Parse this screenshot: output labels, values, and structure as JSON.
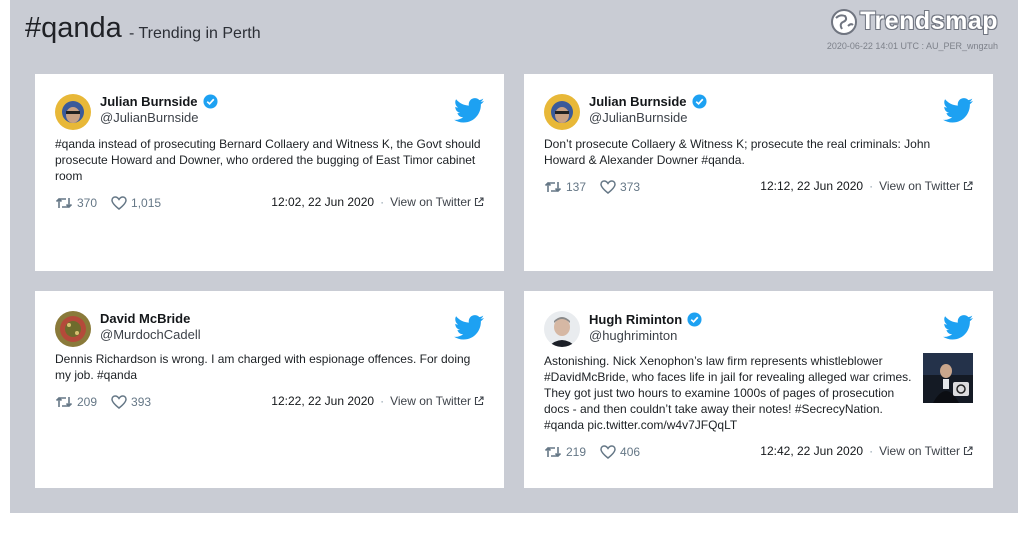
{
  "header": {
    "hashtag": "#qanda",
    "subtitle": "- Trending in Perth",
    "logo_text": "Trendsmap",
    "meta": "2020-06-22 14:01 UTC : AU_PER_wngzuh"
  },
  "tweets": [
    {
      "name": "Julian Burnside",
      "handle": "@JulianBurnside",
      "verified": true,
      "lines": [
        "#qanda instead of prosecuting Bernard Collaery and Witness K, the Govt should",
        "prosecute Howard and Downer, who ordered the bugging of East Timor cabinet",
        "room"
      ],
      "retweets": "370",
      "likes": "1,015",
      "time": "12:02, 22 Jun 2020",
      "view": "View on Twitter"
    },
    {
      "name": "Julian Burnside",
      "handle": "@JulianBurnside",
      "verified": true,
      "lines": [
        "Don’t prosecute Collaery & Witness K; prosecute the real criminals: John",
        "Howard & Alexander Downer #qanda."
      ],
      "retweets": "137",
      "likes": "373",
      "time": "12:12, 22 Jun 2020",
      "view": "View on Twitter"
    },
    {
      "name": "David McBride",
      "handle": "@MurdochCadell",
      "verified": false,
      "lines": [
        "Dennis Richardson is wrong. I am charged with espionage offences. For doing",
        "my job. #qanda"
      ],
      "retweets": "209",
      "likes": "393",
      "time": "12:22, 22 Jun 2020",
      "view": "View on Twitter"
    },
    {
      "name": "Hugh Riminton",
      "handle": "@hughriminton",
      "verified": true,
      "lines": [
        "Astonishing. Nick Xenophon’s law firm represents whistleblower",
        "#DavidMcBride, who faces life in jail for revealing alleged war crimes.",
        "They got just two hours to examine 1000s of pages of prosecution",
        "docs - and then couldn’t take away their notes! #SecrecyNation.",
        "#qanda pic.twitter.com/w4v7JFQqLT"
      ],
      "retweets": "219",
      "likes": "406",
      "time": "12:42, 22 Jun 2020",
      "view": "View on Twitter"
    }
  ],
  "colors": {
    "panel": "#c9ccd4",
    "twitter_blue": "#1da1f2",
    "verified": "#1da1f2"
  }
}
